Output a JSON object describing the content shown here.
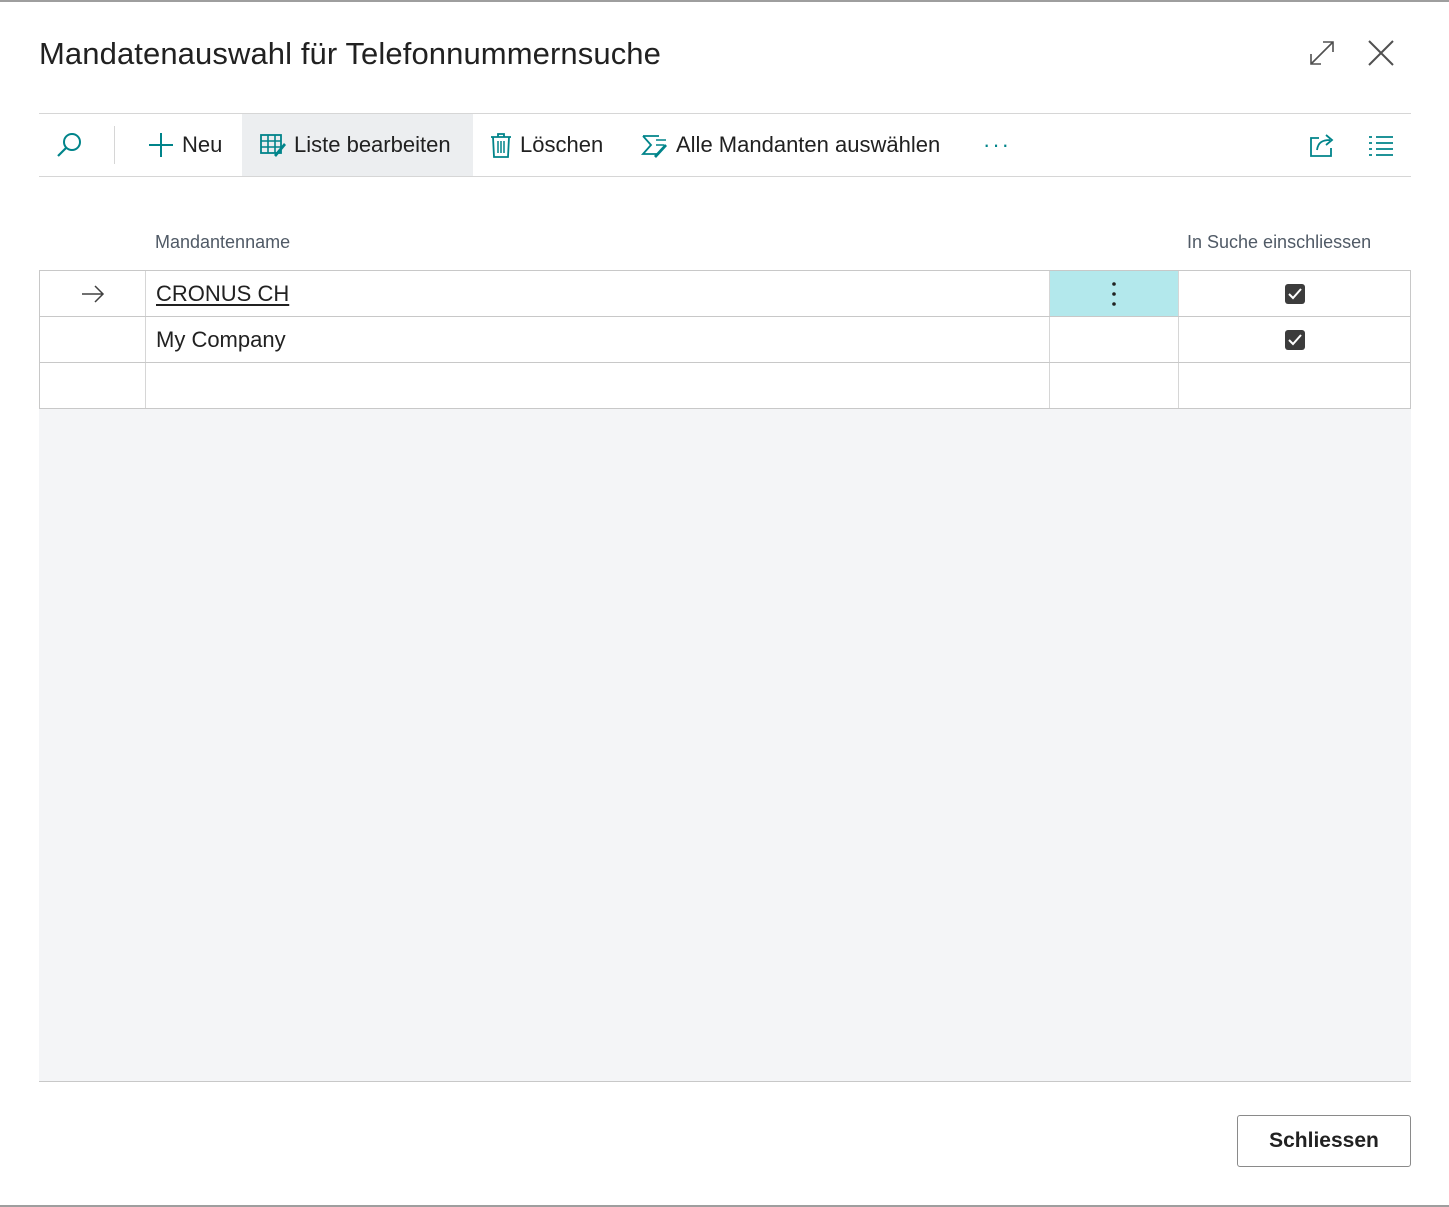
{
  "dialog": {
    "title": "Mandatenauswahl für Telefonnummernsuche"
  },
  "toolbar": {
    "new_label": "Neu",
    "edit_list_label": "Liste bearbeiten",
    "delete_label": "Löschen",
    "select_all_label": "Alle Mandanten auswählen",
    "more_label": "···"
  },
  "table": {
    "columns": [
      "Mandantenname",
      "In Suche einschliessen"
    ],
    "rows": [
      {
        "name": "CRONUS CH",
        "include": true,
        "selected": true
      },
      {
        "name": "My Company",
        "include": true,
        "selected": false
      },
      {
        "name": "",
        "include": null,
        "selected": false
      }
    ]
  },
  "footer": {
    "close_label": "Schliessen"
  },
  "colors": {
    "accent": "#00848a",
    "active_cell": "#b3e8ec",
    "toolbar_active": "#eceef0"
  }
}
